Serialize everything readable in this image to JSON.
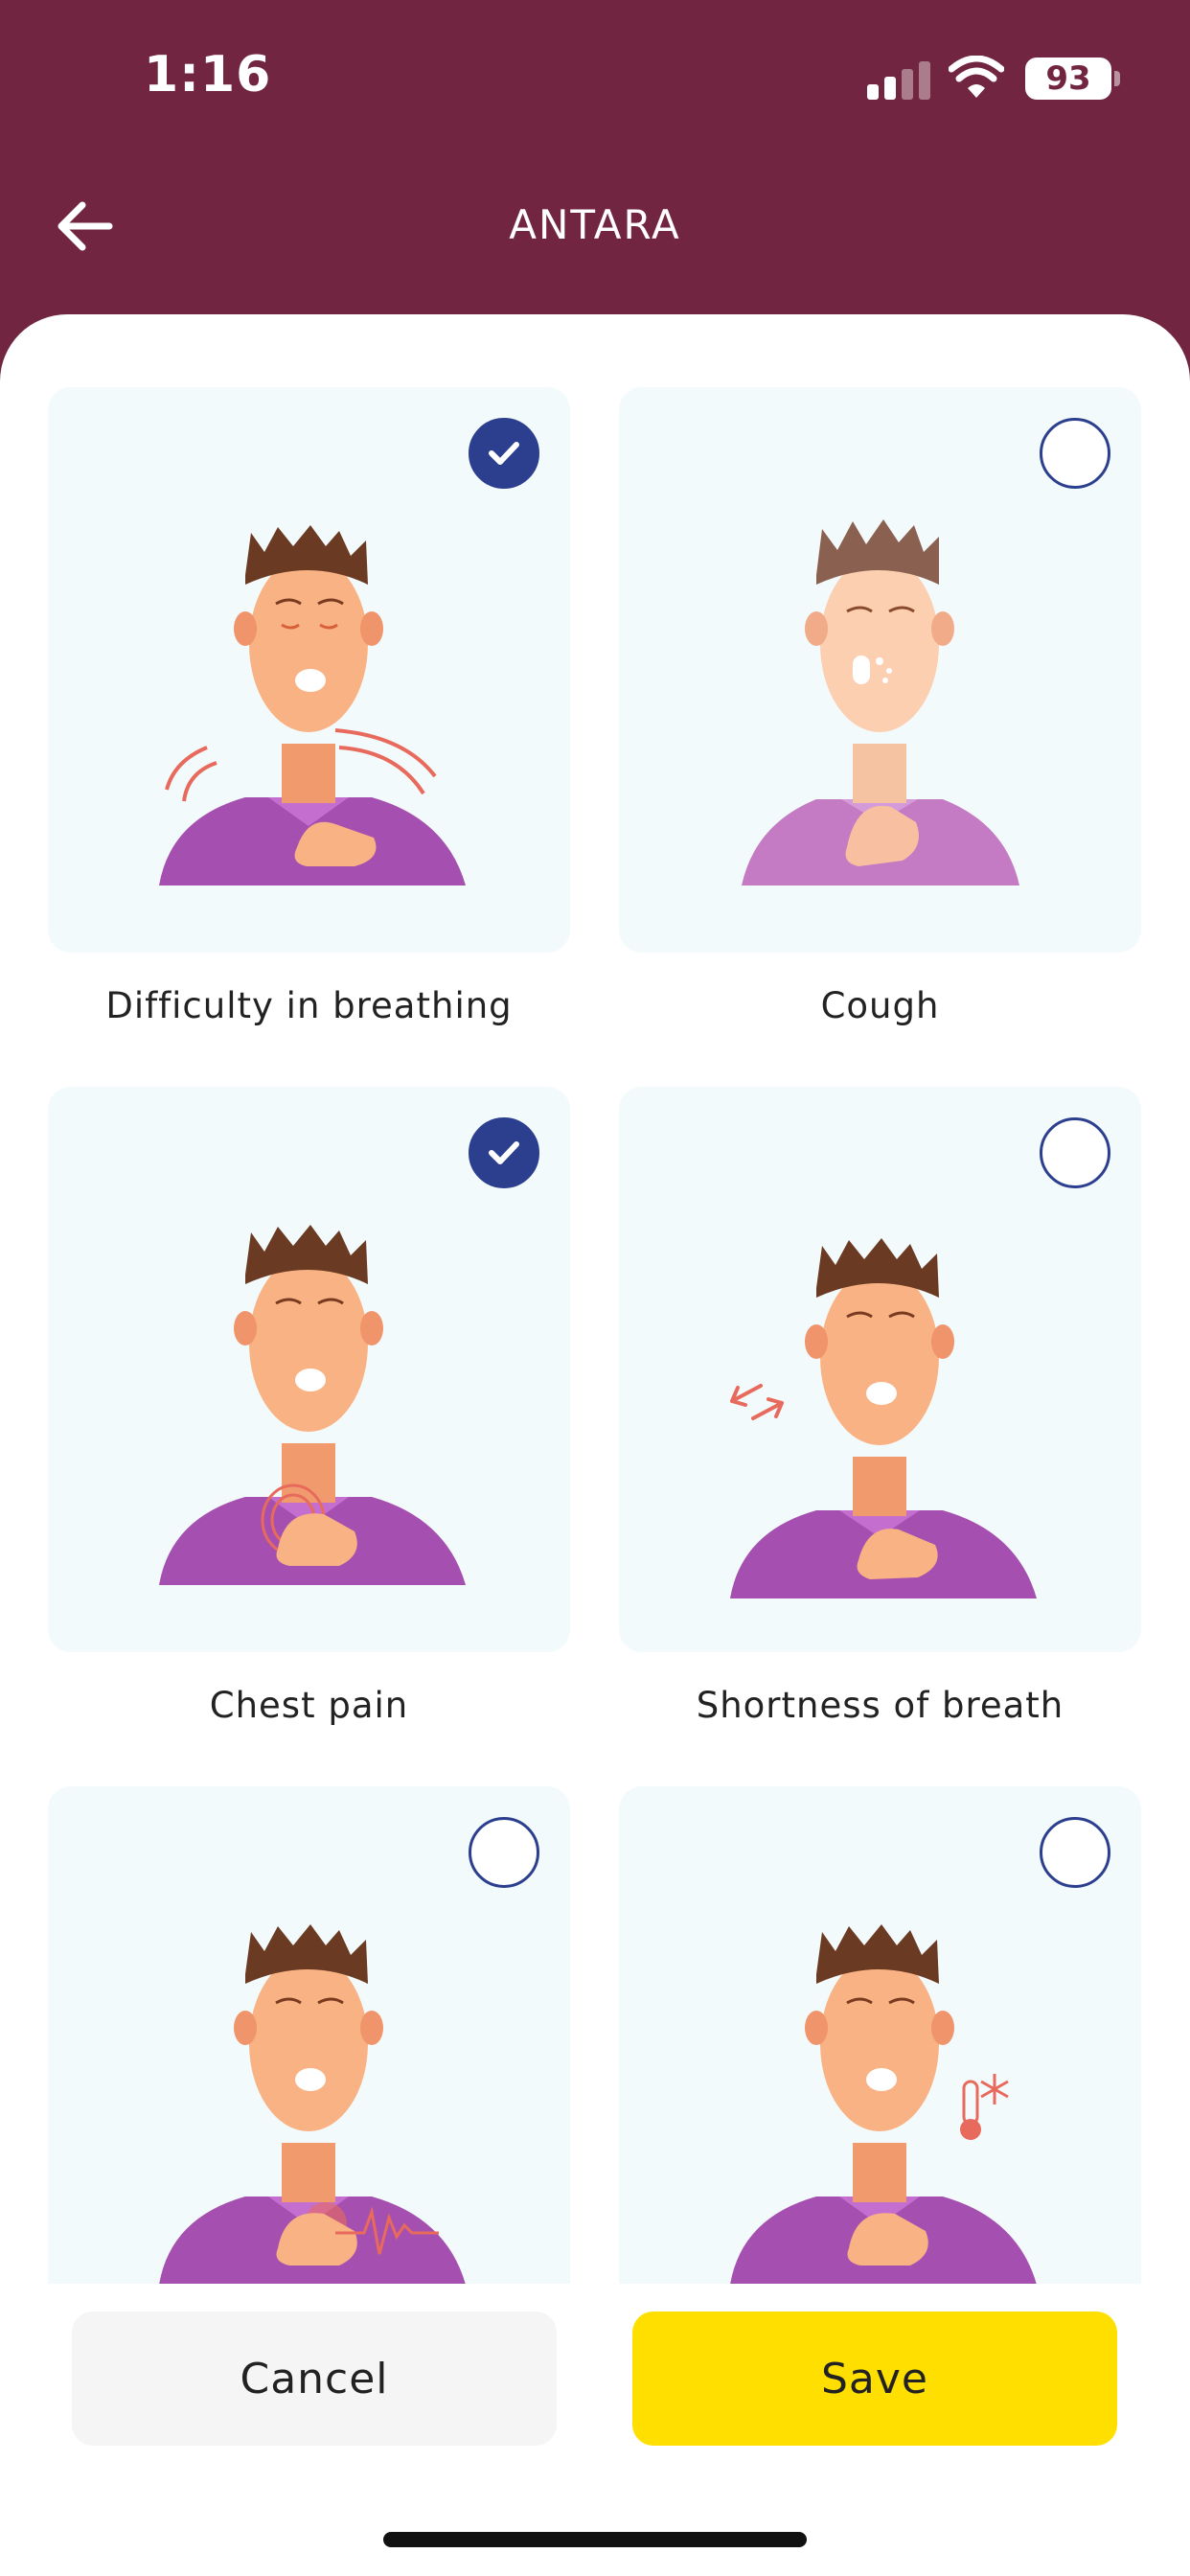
{
  "status_bar": {
    "time": "1:16",
    "battery": "93"
  },
  "header": {
    "title": "ANTARA"
  },
  "symptoms": [
    {
      "label": "Difficulty in breathing",
      "selected": true
    },
    {
      "label": "Cough",
      "selected": false
    },
    {
      "label": "Chest pain",
      "selected": true
    },
    {
      "label": "Shortness of breath",
      "selected": false
    },
    {
      "label": "",
      "selected": false
    },
    {
      "label": "",
      "selected": false
    }
  ],
  "actions": {
    "cancel_label": "Cancel",
    "save_label": "Save"
  },
  "colors": {
    "header_bg": "#722540",
    "checkbox_selected": "#2c3f8f",
    "save_button": "#ffdf00",
    "card_bg": "#f3fafc"
  }
}
